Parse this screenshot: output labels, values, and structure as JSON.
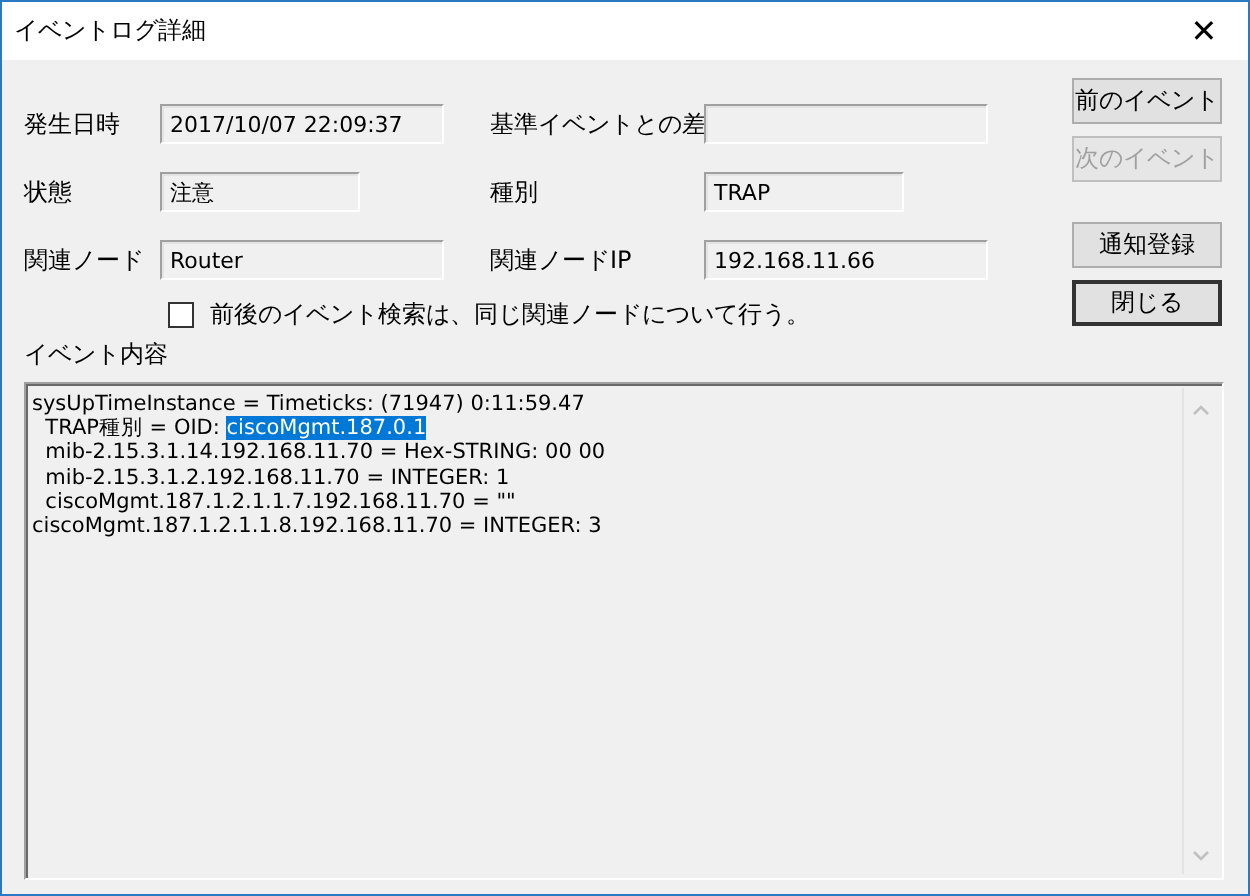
{
  "window": {
    "title": "イベントログ詳細",
    "close": "✕"
  },
  "fields": [
    {
      "label": "発生日時",
      "value": "2017/10/07 22:09:37",
      "wide": true
    },
    {
      "label": "基準イベントとの差",
      "wide": true
    },
    {
      "label": "状態",
      "value": "注意",
      "wide": false
    },
    {
      "label": "種別",
      "value": "TRAP",
      "wide": false
    },
    {
      "label": "関連ノード",
      "value": "Router",
      "wide": true
    },
    {
      "label": "関連ノードIP",
      "value": "192.168.11.66",
      "wide": true
    }
  ],
  "buttons": [
    {
      "label": "前のイベント",
      "disabled": false,
      "default": false
    },
    {
      "label": "次のイベント",
      "disabled": true,
      "default": false
    },
    {
      "label": "通知登録",
      "disabled": false,
      "default": false
    },
    {
      "label": "閉じる",
      "disabled": false,
      "default": true
    }
  ],
  "checkbox": {
    "label": "前後のイベント検索は、同じ関連ノードについて行う。",
    "checked": false
  },
  "content": {
    "label": "イベント内容",
    "lines": [
      [
        {
          "text": "sysUpTimeInstance = Timeticks: (71947) 0:11:59.47",
          "selected": false
        }
      ],
      [
        {
          "text": "  TRAP種別 = OID: ",
          "selected": false
        },
        {
          "text": "ciscoMgmt.187.0.1",
          "selected": true
        }
      ],
      [
        {
          "text": "  mib-2.15.3.1.14.192.168.11.70 = Hex-STRING: 00 00",
          "selected": false
        }
      ],
      [
        {
          "text": "  mib-2.15.3.1.2.192.168.11.70 = INTEGER: 1",
          "selected": false
        }
      ],
      [
        {
          "text": "  ciscoMgmt.187.1.2.1.1.7.192.168.11.70 = \"\"",
          "selected": false
        }
      ],
      [
        {
          "text": "ciscoMgmt.187.1.2.1.1.8.192.168.11.70 = INTEGER: 3",
          "selected": false
        }
      ]
    ]
  }
}
